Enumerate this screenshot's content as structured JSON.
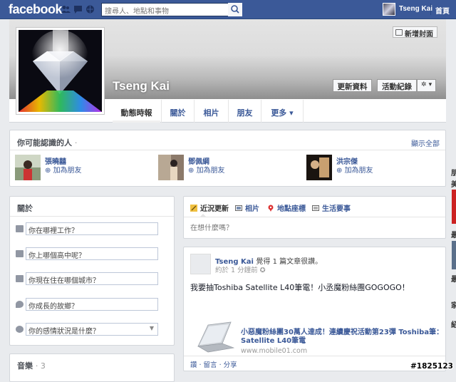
{
  "topbar": {
    "logo": "facebook",
    "search_placeholder": "搜尋人、地點和事物",
    "user_name": "Tseng Kai",
    "home_link": "首頁"
  },
  "profile": {
    "name": "Tseng Kai",
    "add_cover": "新增封面",
    "update_info": "更新資料",
    "activity_log": "活動紀錄",
    "settings": "✲ ▾",
    "tabs": [
      "動態時報",
      "關於",
      "相片",
      "朋友",
      "更多 ▾"
    ]
  },
  "pymk": {
    "title": "你可能認識的人",
    "show_all": "顯示全部",
    "people": [
      {
        "name": "張曉囍",
        "action": "加為朋友"
      },
      {
        "name": "鄧佩綱",
        "action": "加為朋友"
      },
      {
        "name": "洪宗傑",
        "action": "加為朋友"
      }
    ]
  },
  "about": {
    "title": "關於",
    "fields": [
      {
        "icon": "work-icon",
        "placeholder": "你在哪裡工作？"
      },
      {
        "icon": "education-icon",
        "placeholder": "你上哪個高中呢？"
      },
      {
        "icon": "home-icon",
        "placeholder": "你現在住在哪個城市？"
      },
      {
        "icon": "location-icon",
        "placeholder": "你成長的故鄉？"
      },
      {
        "icon": "heart-icon",
        "placeholder": "你的感情狀況是什麼？"
      }
    ]
  },
  "music": {
    "title": "音樂",
    "count": "· 3"
  },
  "composer": {
    "tabs": [
      "近況更新",
      "相片",
      "地點座標",
      "生活要事"
    ],
    "placeholder": "在想什麼嗎？"
  },
  "post": {
    "author": "Tseng Kai",
    "action": "覺得 1 篇文章很讚。",
    "time": "約於 1 分鐘前",
    "text": "我要抽Toshiba Satellite L40筆電！小丞魔粉絲團GOGOGO！",
    "link_title": "小惡魔粉絲團30萬人達成！連續慶祝活動第23彈 Toshiba筆：Satellite L40筆電",
    "link_url": "www.mobile01.com",
    "actions": "讚 · 留言 · 分享"
  },
  "sidebar_right": {
    "letters": [
      "朋",
      "美",
      "最",
      "最",
      "家",
      "紹"
    ]
  },
  "watermark": "#1825123",
  "colors": {
    "brand": "#3b5998",
    "background": "#e9ebee",
    "link": "#3b5998"
  }
}
